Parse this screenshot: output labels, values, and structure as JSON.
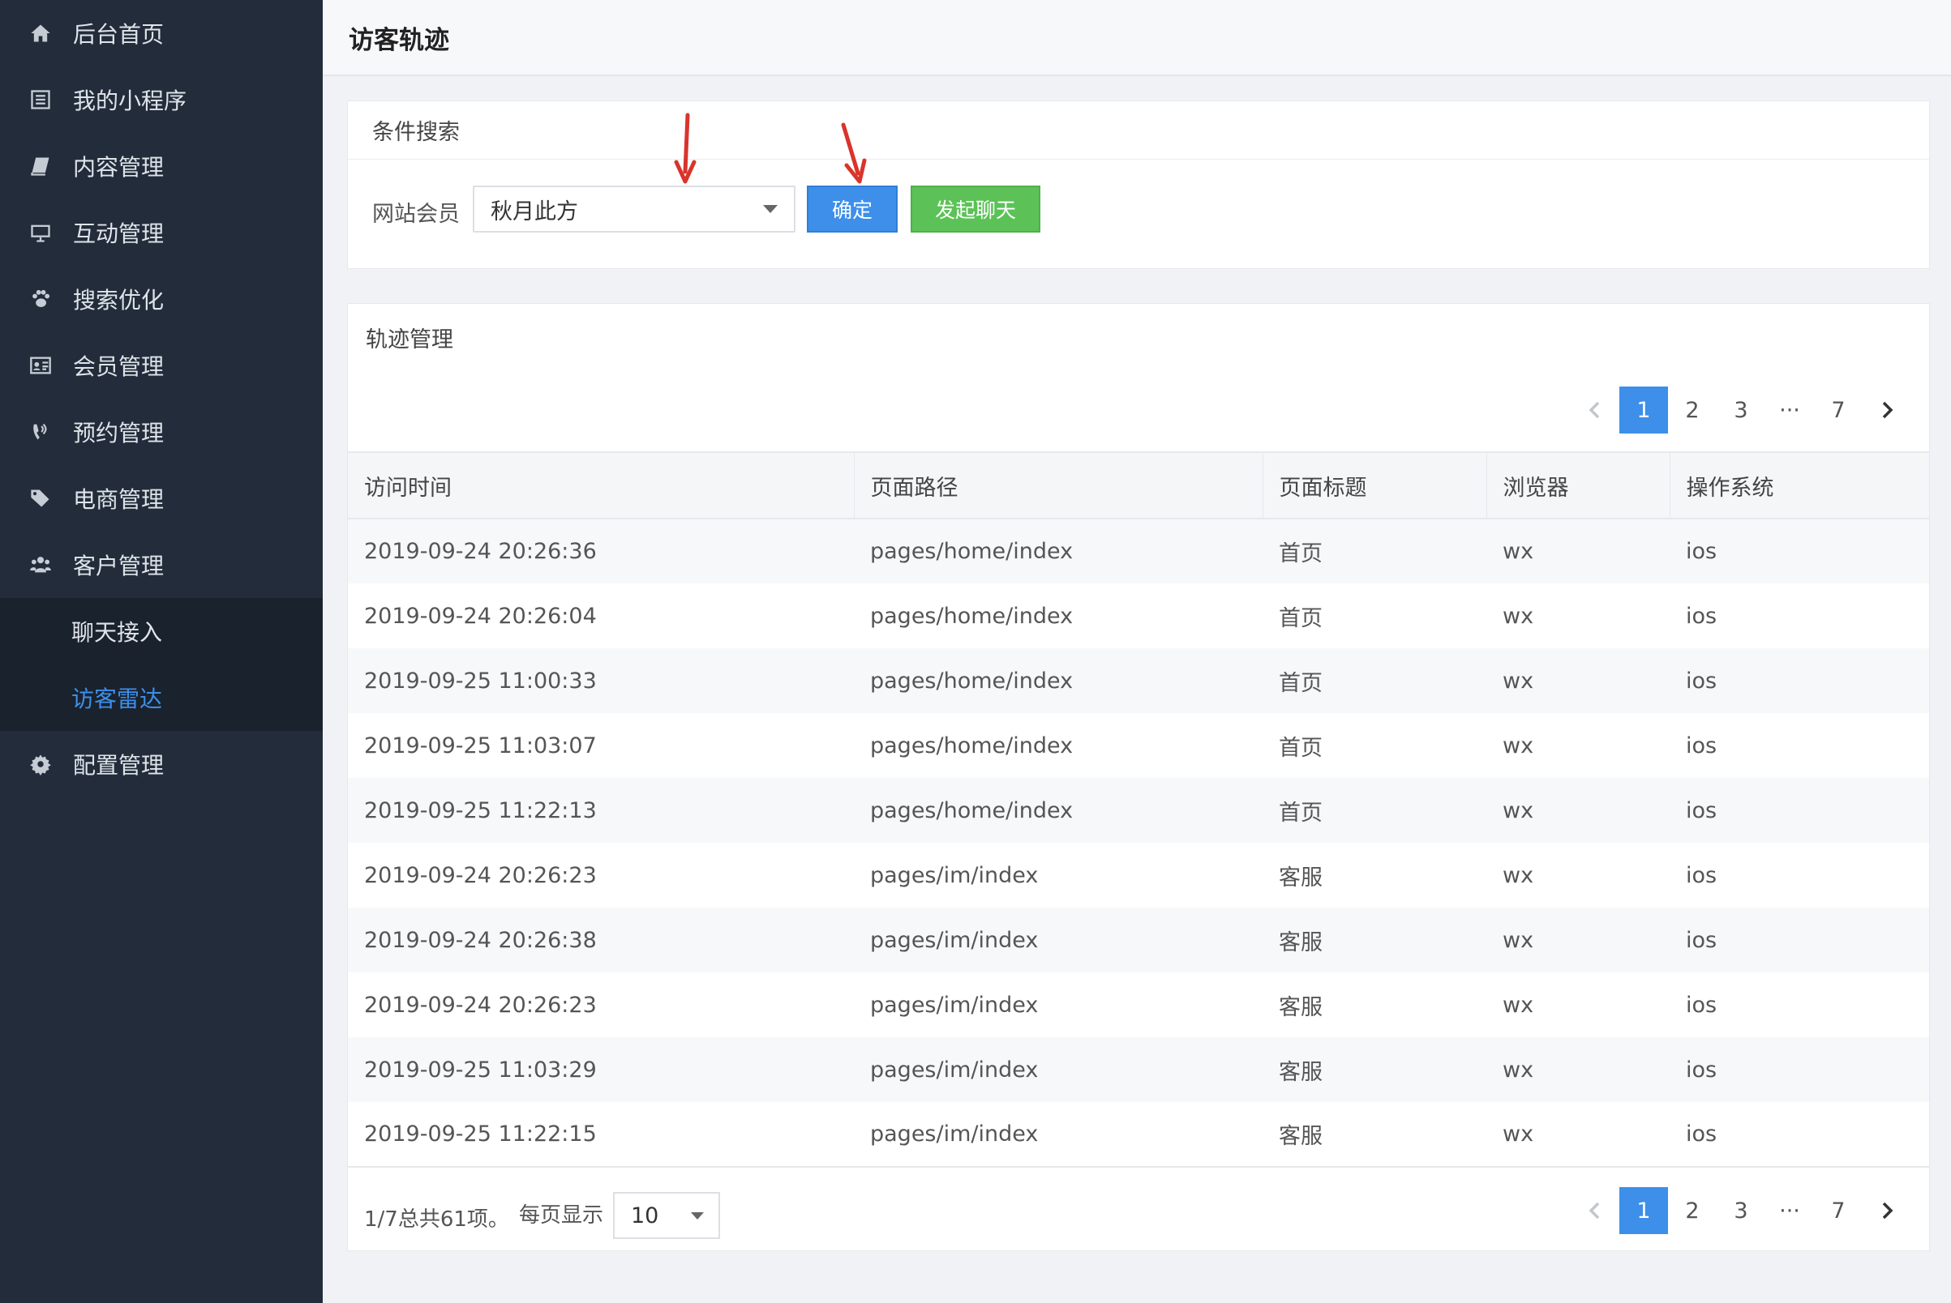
{
  "sidebar": {
    "items": [
      {
        "label": "后台首页",
        "icon": "home-icon"
      },
      {
        "label": "我的小程序",
        "icon": "list-icon"
      },
      {
        "label": "内容管理",
        "icon": "book-icon"
      },
      {
        "label": "互动管理",
        "icon": "monitor-icon"
      },
      {
        "label": "搜索优化",
        "icon": "paw-icon"
      },
      {
        "label": "会员管理",
        "icon": "id-card-icon"
      },
      {
        "label": "预约管理",
        "icon": "phone-signal-icon"
      },
      {
        "label": "电商管理",
        "icon": "tags-icon"
      },
      {
        "label": "客户管理",
        "icon": "users-icon"
      }
    ],
    "subitems": [
      {
        "label": "聊天接入",
        "active": false
      },
      {
        "label": "访客雷达",
        "active": true
      }
    ],
    "config": {
      "label": "配置管理",
      "icon": "gear-icon"
    }
  },
  "header": {
    "title": "访客轨迹"
  },
  "search": {
    "title": "条件搜索",
    "member_label": "网站会员",
    "member_value": "秋月此方",
    "confirm_label": "确定",
    "chat_label": "发起聊天"
  },
  "track": {
    "title": "轨迹管理",
    "columns": [
      "访问时间",
      "页面路径",
      "页面标题",
      "浏览器",
      "操作系统"
    ],
    "rows": [
      [
        "2019-09-24 20:26:36",
        "pages/home/index",
        "首页",
        "wx",
        "ios"
      ],
      [
        "2019-09-24 20:26:04",
        "pages/home/index",
        "首页",
        "wx",
        "ios"
      ],
      [
        "2019-09-25 11:00:33",
        "pages/home/index",
        "首页",
        "wx",
        "ios"
      ],
      [
        "2019-09-25 11:03:07",
        "pages/home/index",
        "首页",
        "wx",
        "ios"
      ],
      [
        "2019-09-25 11:22:13",
        "pages/home/index",
        "首页",
        "wx",
        "ios"
      ],
      [
        "2019-09-24 20:26:23",
        "pages/im/index",
        "客服",
        "wx",
        "ios"
      ],
      [
        "2019-09-24 20:26:38",
        "pages/im/index",
        "客服",
        "wx",
        "ios"
      ],
      [
        "2019-09-24 20:26:23",
        "pages/im/index",
        "客服",
        "wx",
        "ios"
      ],
      [
        "2019-09-25 11:03:29",
        "pages/im/index",
        "客服",
        "wx",
        "ios"
      ],
      [
        "2019-09-25 11:22:15",
        "pages/im/index",
        "客服",
        "wx",
        "ios"
      ]
    ]
  },
  "pagination": {
    "pages": [
      "1",
      "2",
      "3",
      "···",
      "7"
    ],
    "current": "1",
    "summary": "1/7总共61项。",
    "per_page_label": "每页显示",
    "per_page_value": "10"
  },
  "colors": {
    "sidebar": "#222c3a",
    "accent": "#3d8fea",
    "chat_button": "#5cc257",
    "annotation_arrow": "#d9342b"
  }
}
